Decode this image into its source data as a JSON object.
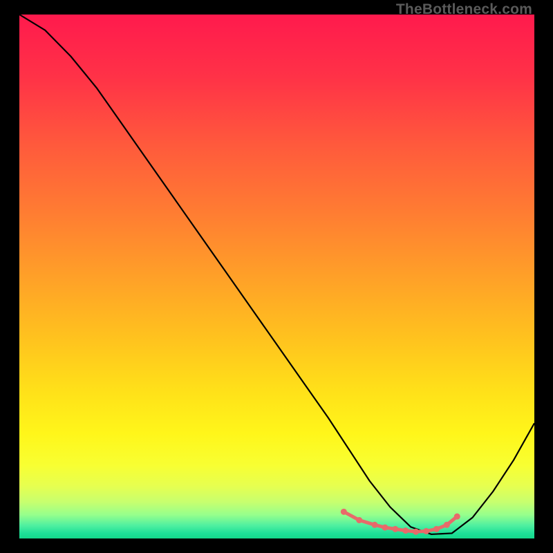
{
  "watermark": "TheBottleneck.com",
  "chart_data": {
    "type": "line",
    "title": "",
    "xlabel": "",
    "ylabel": "",
    "xlim": [
      0,
      100
    ],
    "ylim": [
      0,
      100
    ],
    "x": [
      0,
      5,
      10,
      15,
      20,
      25,
      30,
      35,
      40,
      45,
      50,
      55,
      60,
      64,
      68,
      72,
      76,
      80,
      84,
      88,
      92,
      96,
      100
    ],
    "values": [
      100,
      97,
      92,
      86,
      79,
      72,
      65,
      58,
      51,
      44,
      37,
      30,
      23,
      17,
      11,
      6,
      2.2,
      0.8,
      1.0,
      4,
      9,
      15,
      22
    ],
    "optimal_band_x": [
      63,
      66,
      69,
      71,
      73,
      75,
      77,
      79,
      81,
      83,
      85
    ],
    "optimal_band_y": [
      5.1,
      3.5,
      2.6,
      2.1,
      1.8,
      1.5,
      1.3,
      1.4,
      1.8,
      2.6,
      4.2
    ],
    "background_gradient": {
      "stops": [
        {
          "offset": 0.0,
          "color": "#ff1a4d"
        },
        {
          "offset": 0.12,
          "color": "#ff3247"
        },
        {
          "offset": 0.25,
          "color": "#ff5a3c"
        },
        {
          "offset": 0.38,
          "color": "#ff7d32"
        },
        {
          "offset": 0.5,
          "color": "#ffa028"
        },
        {
          "offset": 0.62,
          "color": "#ffc31e"
        },
        {
          "offset": 0.72,
          "color": "#ffe119"
        },
        {
          "offset": 0.8,
          "color": "#fff61a"
        },
        {
          "offset": 0.86,
          "color": "#f8ff32"
        },
        {
          "offset": 0.9,
          "color": "#e6ff50"
        },
        {
          "offset": 0.93,
          "color": "#c8ff6e"
        },
        {
          "offset": 0.955,
          "color": "#96ff8c"
        },
        {
          "offset": 0.975,
          "color": "#50f0a0"
        },
        {
          "offset": 0.99,
          "color": "#1ee098"
        },
        {
          "offset": 1.0,
          "color": "#14d88a"
        }
      ]
    },
    "curve_color": "#000000",
    "marker_color": "#e86a6a"
  }
}
